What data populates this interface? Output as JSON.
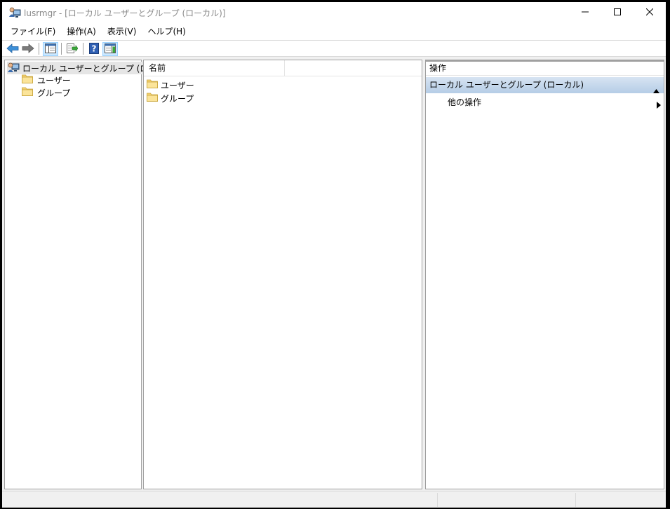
{
  "window": {
    "title": "lusrmgr - [ローカル ユーザーとグループ (ローカル)]",
    "icon": "users-computer-icon"
  },
  "menu": {
    "items": [
      {
        "label": "ファイル(F)"
      },
      {
        "label": "操作(A)"
      },
      {
        "label": "表示(V)"
      },
      {
        "label": "ヘルプ(H)"
      }
    ]
  },
  "toolbar": {
    "buttons": [
      {
        "icon": "back-arrow-icon"
      },
      {
        "icon": "forward-arrow-icon"
      },
      {
        "icon": "show-hide-console-tree-icon"
      },
      {
        "icon": "export-list-icon"
      },
      {
        "icon": "help-icon"
      },
      {
        "icon": "show-hide-action-pane-icon"
      }
    ]
  },
  "tree": {
    "root": {
      "label": "ローカル ユーザーとグループ (ローカル)"
    },
    "children": [
      {
        "label": "ユーザー"
      },
      {
        "label": "グループ"
      }
    ]
  },
  "list": {
    "columns": [
      {
        "label": "名前"
      }
    ],
    "rows": [
      {
        "label": "ユーザー"
      },
      {
        "label": "グループ"
      }
    ]
  },
  "actions": {
    "header": "操作",
    "section": "ローカル ユーザーとグループ (ローカル)",
    "items": [
      {
        "label": "他の操作"
      }
    ]
  },
  "colors": {
    "accent_blue": "#3c8fd8",
    "folder_yellow": "#f5d272",
    "section_gradient_top": "#d7e4f2",
    "section_gradient_bottom": "#b5cde6"
  }
}
